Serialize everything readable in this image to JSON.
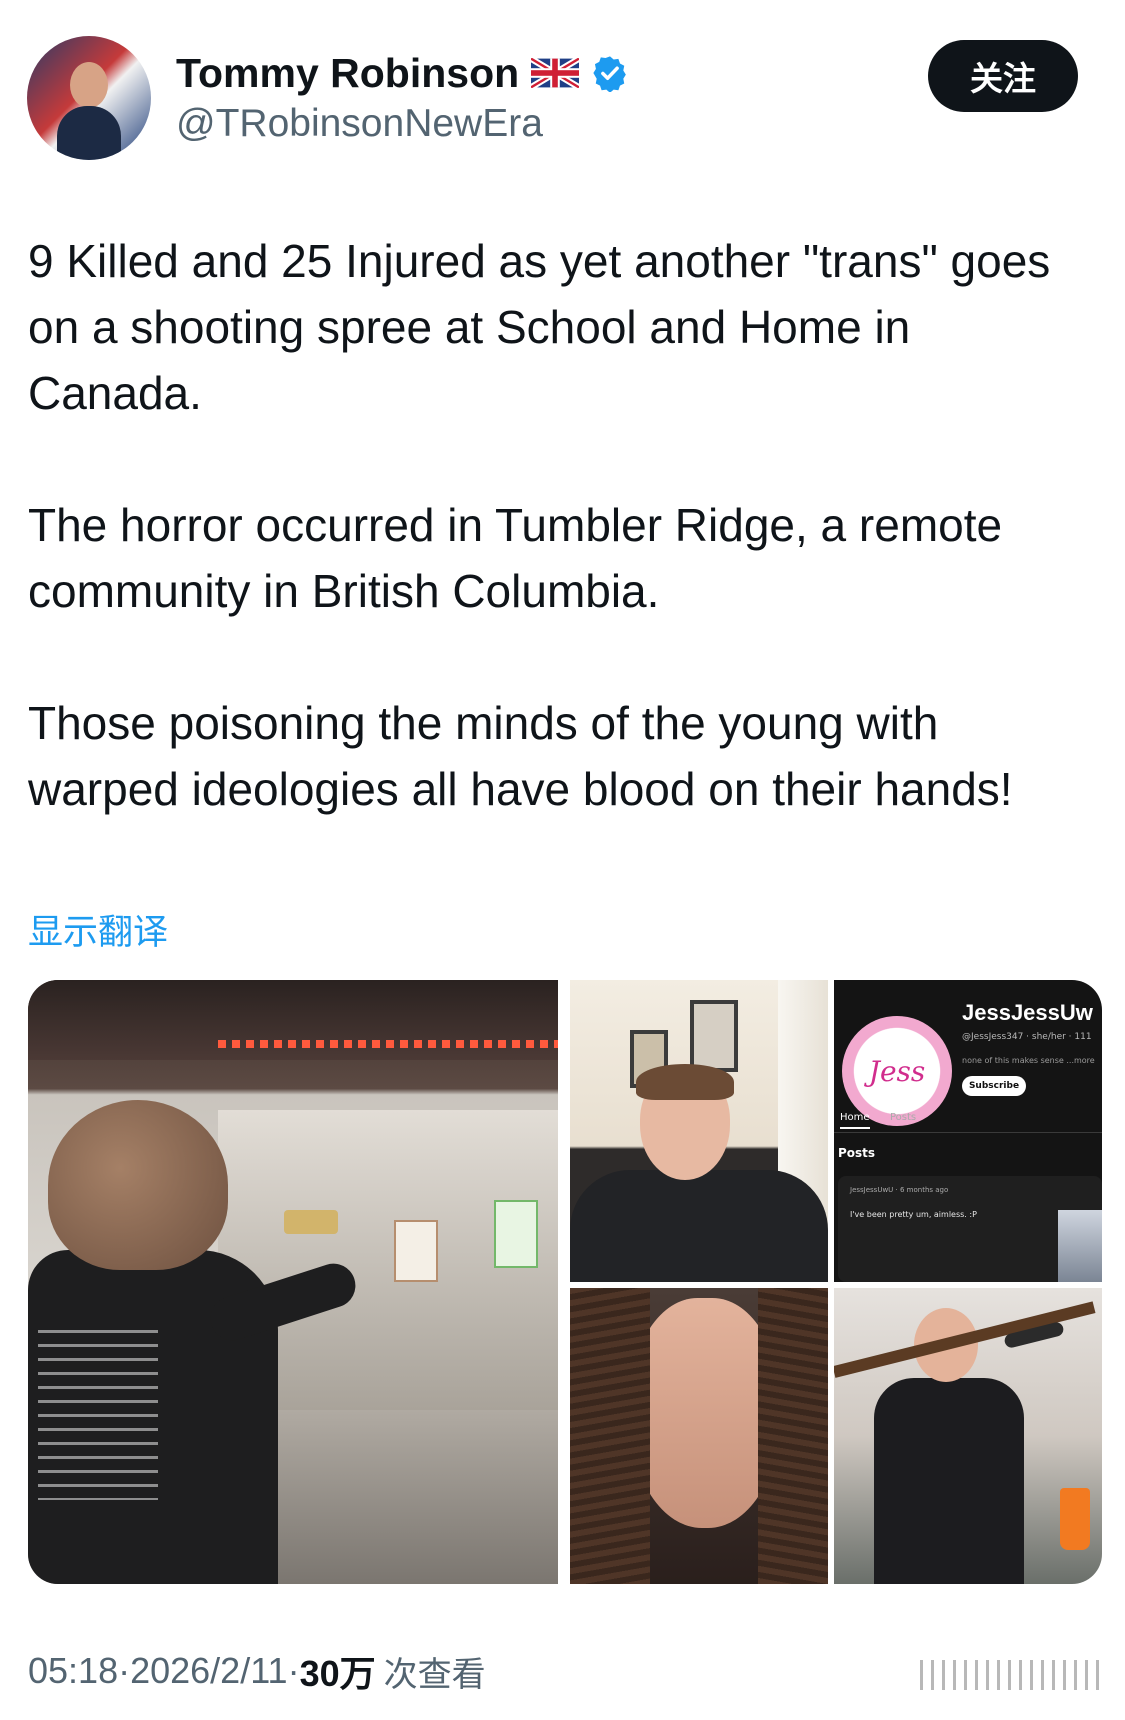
{
  "author": {
    "display_name": "Tommy Robinson",
    "handle": "@TRobinsonNewEra",
    "flag_icon": "uk-flag-icon",
    "verified_icon": "verified-badge-icon"
  },
  "follow_button": {
    "label": "关注"
  },
  "tweet": {
    "paragraphs": [
      "9 Killed and 25 Injured as yet another \"trans\" goes\non a shooting spree at School and Home in\nCanada.",
      "The horror occurred in Tumbler Ridge, a remote\ncommunity in British Columbia.",
      "Those poisoning the minds of the young with\nwarped ideologies all have blood on their hands!"
    ],
    "translate_label": "显示翻译"
  },
  "media": {
    "profile_card": {
      "avatar_text": "Jess",
      "channel_name": "JessJessUw",
      "meta": "@JessJess347 · she/her · 111",
      "description": "none of this makes sense ...more",
      "subscribe_label": "Subscribe",
      "tabs": [
        "Home",
        "Posts"
      ],
      "posts_heading": "Posts",
      "post_meta": "JessJessUwU · 6 months ago",
      "post_text": "I've been pretty um, aimless. :P"
    }
  },
  "footer": {
    "time": "05:18",
    "separator": " · ",
    "date": "2026/2/11",
    "views_count": "30万",
    "views_label": "次查看"
  },
  "colors": {
    "link": "#1d9bf0",
    "secondary_text": "#536471",
    "primary_text": "#0f1419",
    "follow_bg": "#0f1419"
  }
}
